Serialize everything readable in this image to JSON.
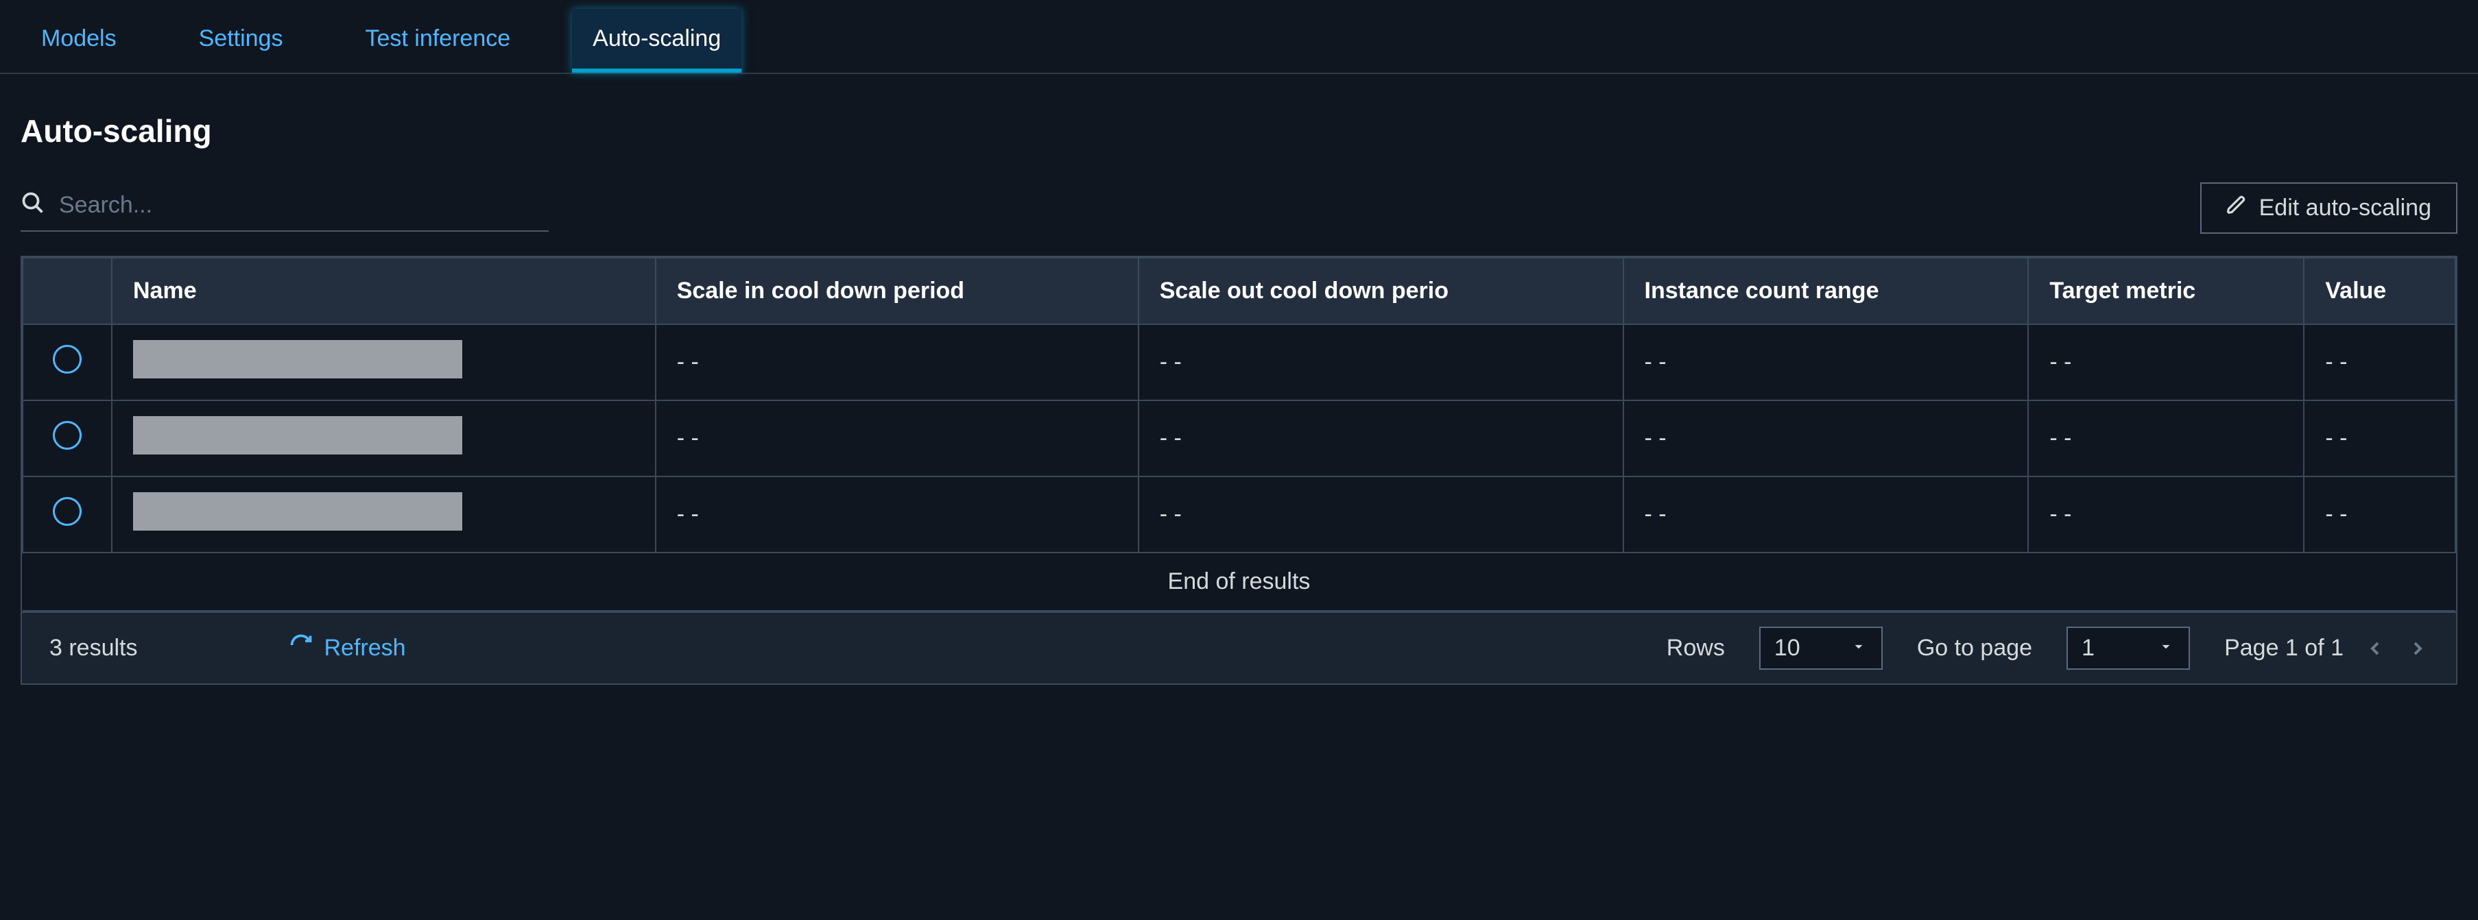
{
  "tabs": [
    {
      "label": "Models",
      "active": false
    },
    {
      "label": "Settings",
      "active": false
    },
    {
      "label": "Test inference",
      "active": false
    },
    {
      "label": "Auto-scaling",
      "active": true
    }
  ],
  "heading": "Auto-scaling",
  "search": {
    "placeholder": "Search..."
  },
  "edit_button": "Edit auto-scaling",
  "table": {
    "headers": [
      "Name",
      "Scale in cool down period",
      "Scale out cool down perio",
      "Instance count range",
      "Target metric",
      "Value"
    ],
    "rows": [
      {
        "scale_in": "- -",
        "scale_out": "- -",
        "range": "- -",
        "metric": "- -",
        "value": "- -"
      },
      {
        "scale_in": "- -",
        "scale_out": "- -",
        "range": "- -",
        "metric": "- -",
        "value": "- -"
      },
      {
        "scale_in": "- -",
        "scale_out": "- -",
        "range": "- -",
        "metric": "- -",
        "value": "- -"
      }
    ],
    "end_of_results": "End of results"
  },
  "footer": {
    "results_count": "3 results",
    "refresh": "Refresh",
    "rows_label": "Rows",
    "rows_value": "10",
    "goto_label": "Go to page",
    "goto_value": "1",
    "page_text": "Page 1 of 1"
  }
}
